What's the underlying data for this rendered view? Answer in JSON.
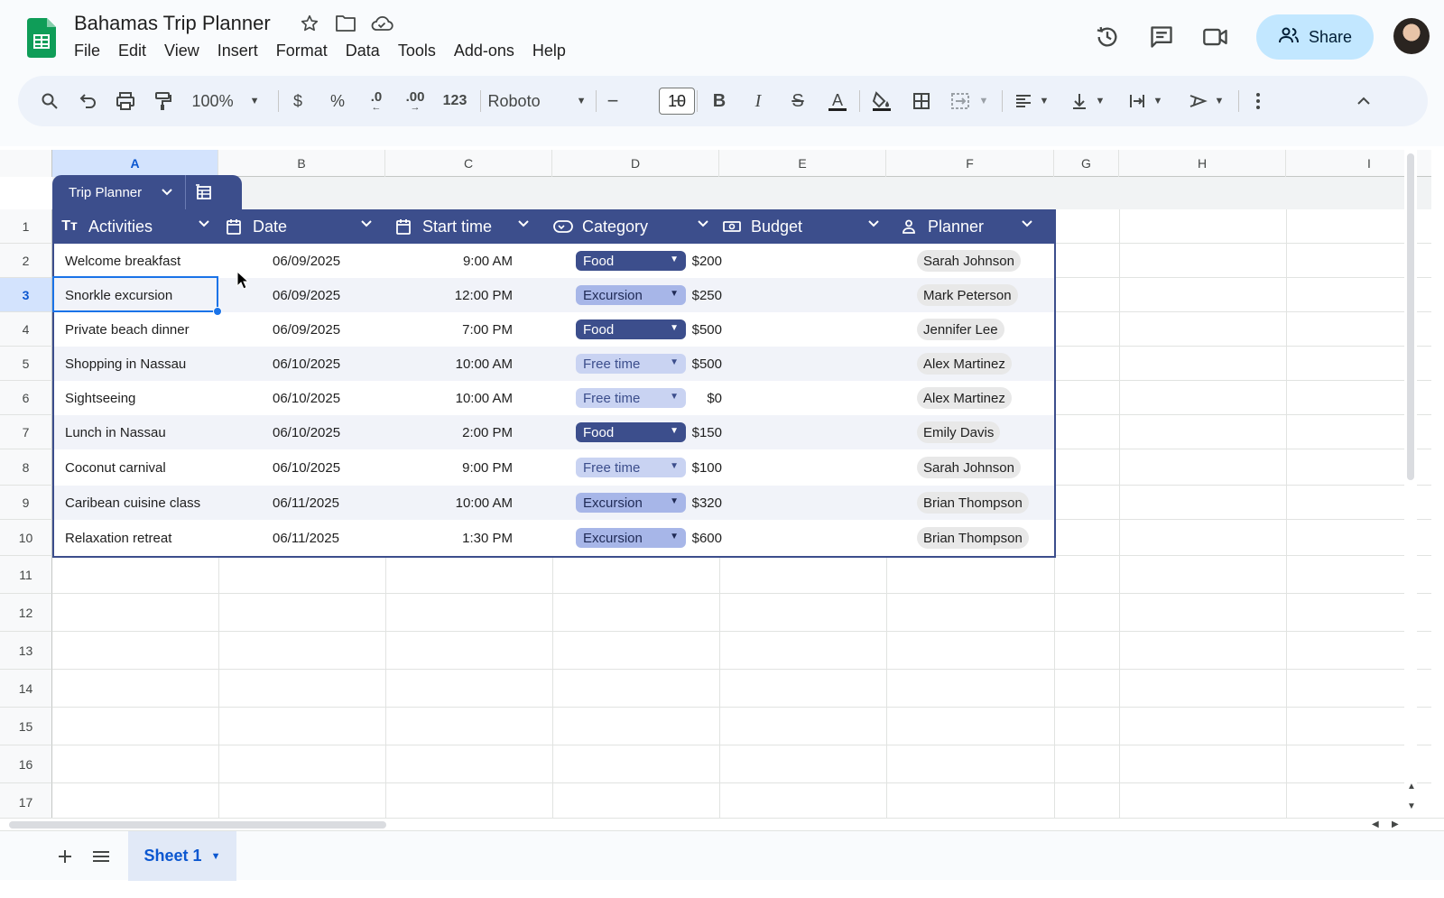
{
  "app": {
    "title": "Bahamas Trip Planner"
  },
  "menu": [
    "File",
    "Edit",
    "View",
    "Insert",
    "Format",
    "Data",
    "Tools",
    "Add-ons",
    "Help"
  ],
  "share_label": "Share",
  "toolbar": {
    "zoom": "100%",
    "currency": "$",
    "percent": "%",
    "dec_decrease": ".0",
    "dec_increase": ".00",
    "more_formats": "123",
    "font": "Roboto",
    "font_size": "10"
  },
  "columns": [
    "A",
    "B",
    "C",
    "D",
    "E",
    "F",
    "G",
    "H",
    "I"
  ],
  "rows": [
    "1",
    "2",
    "3",
    "4",
    "5",
    "6",
    "7",
    "8",
    "9",
    "10",
    "11",
    "12",
    "13",
    "14",
    "15",
    "16",
    "17"
  ],
  "table": {
    "name": "Trip Planner",
    "headers": [
      "Activities",
      "Date",
      "Start time",
      "Category",
      "Budget",
      "Planner"
    ],
    "rows": [
      {
        "activity": "Welcome breakfast",
        "date": "06/09/2025",
        "time": "9:00 AM",
        "category": "Food",
        "budget": "$200",
        "planner": "Sarah Johnson"
      },
      {
        "activity": "Snorkle excursion",
        "date": "06/09/2025",
        "time": "12:00 PM",
        "category": "Excursion",
        "budget": "$250",
        "planner": "Mark Peterson"
      },
      {
        "activity": "Private beach dinner",
        "date": "06/09/2025",
        "time": "7:00 PM",
        "category": "Food",
        "budget": "$500",
        "planner": "Jennifer Lee"
      },
      {
        "activity": "Shopping in Nassau",
        "date": "06/10/2025",
        "time": "10:00 AM",
        "category": "Free time",
        "budget": "$500",
        "planner": "Alex Martinez"
      },
      {
        "activity": "Sightseeing",
        "date": "06/10/2025",
        "time": "10:00 AM",
        "category": "Free time",
        "budget": "$0",
        "planner": "Alex Martinez"
      },
      {
        "activity": "Lunch in Nassau",
        "date": "06/10/2025",
        "time": "2:00 PM",
        "category": "Food",
        "budget": "$150",
        "planner": "Emily Davis"
      },
      {
        "activity": "Coconut carnival",
        "date": "06/10/2025",
        "time": "9:00 PM",
        "category": "Free time",
        "budget": "$100",
        "planner": "Sarah Johnson"
      },
      {
        "activity": "Caribean cuisine class",
        "date": "06/11/2025",
        "time": "10:00 AM",
        "category": "Excursion",
        "budget": "$320",
        "planner": "Brian Thompson"
      },
      {
        "activity": "Relaxation retreat",
        "date": "06/11/2025",
        "time": "1:30 PM",
        "category": "Excursion",
        "budget": "$600",
        "planner": "Brian Thompson"
      }
    ]
  },
  "category_colors": {
    "Food": {
      "bg": "#3c4e8c",
      "fg": "#ffffff"
    },
    "Excursion": {
      "bg": "#a7b6e8",
      "fg": "#1f2a55"
    },
    "Free time": {
      "bg": "#c9d3f2",
      "fg": "#3c4e8c"
    }
  },
  "sheet_tab": "Sheet 1",
  "selected_cell": "A3",
  "colors": {
    "accent": "#0b57d0",
    "table_header": "#3c4e8c",
    "share_bg": "#c2e7ff",
    "toolbar_bg": "#edf2fa"
  }
}
